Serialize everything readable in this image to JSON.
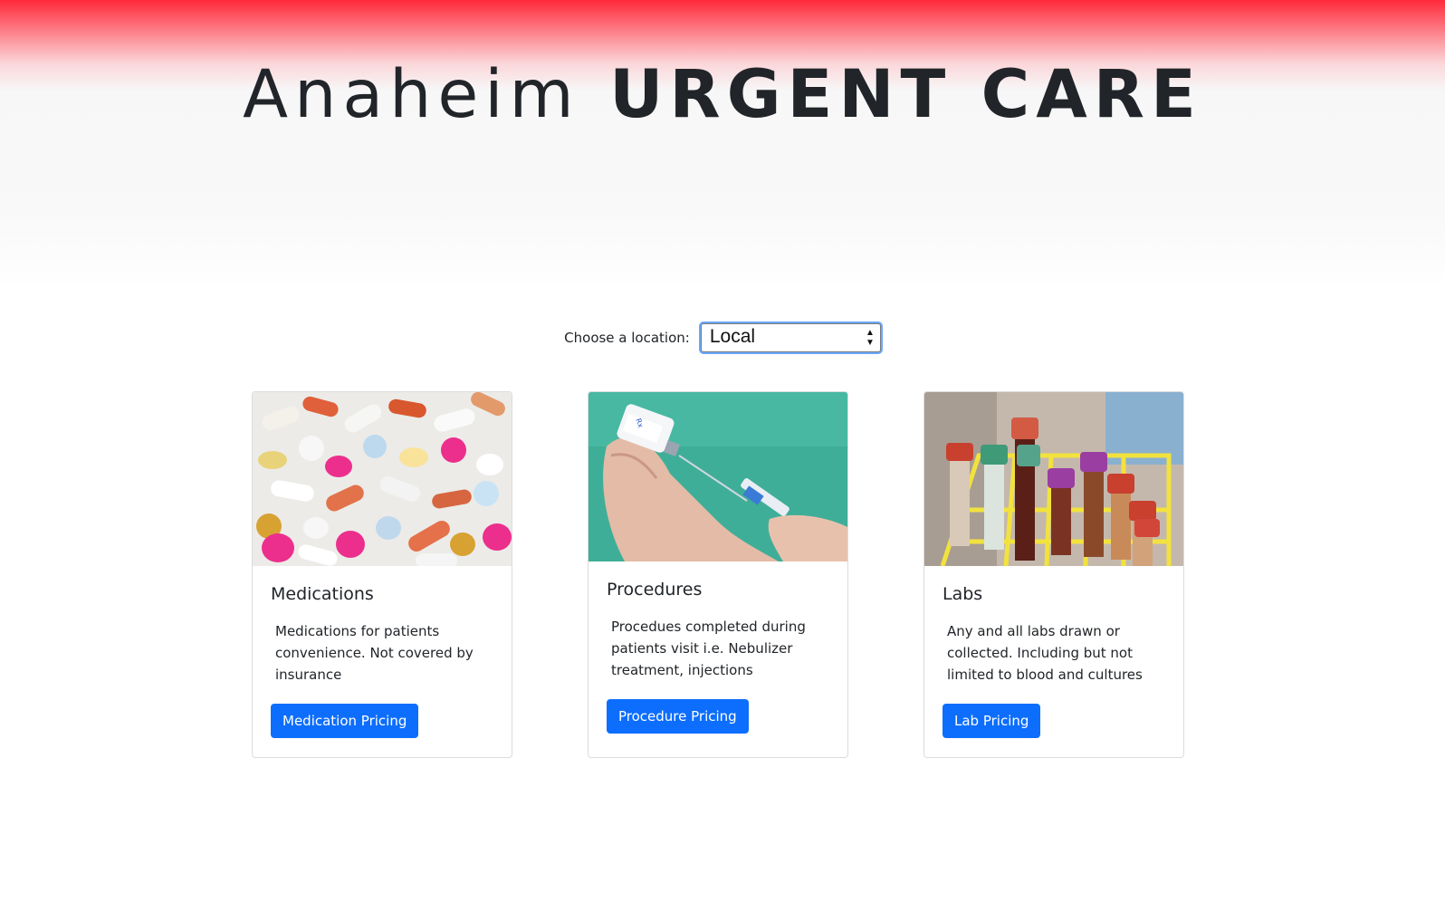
{
  "header": {
    "title_light": "Anaheim",
    "title_bold": "URGENT CARE"
  },
  "location": {
    "label": "Choose a location:",
    "selected": "Local"
  },
  "cards": [
    {
      "title": "Medications",
      "text": "Medications for patients convenience. Not covered by insurance",
      "button": "Medication Pricing",
      "image_icon": "pills-photo"
    },
    {
      "title": "Procedures",
      "text": "Procedues completed during patients visit i.e. Nebulizer treatment, injections",
      "button": "Procedure Pricing",
      "image_icon": "syringe-vial-photo"
    },
    {
      "title": "Labs",
      "text": "Any and all labs drawn or collected. Including but not limited to blood and cultures",
      "button": "Lab Pricing",
      "image_icon": "blood-tubes-photo"
    }
  ],
  "colors": {
    "header_gradient_top": "#ff2a3a",
    "button_primary": "#0d6efd",
    "select_focus_ring": "#6aa8ff"
  }
}
